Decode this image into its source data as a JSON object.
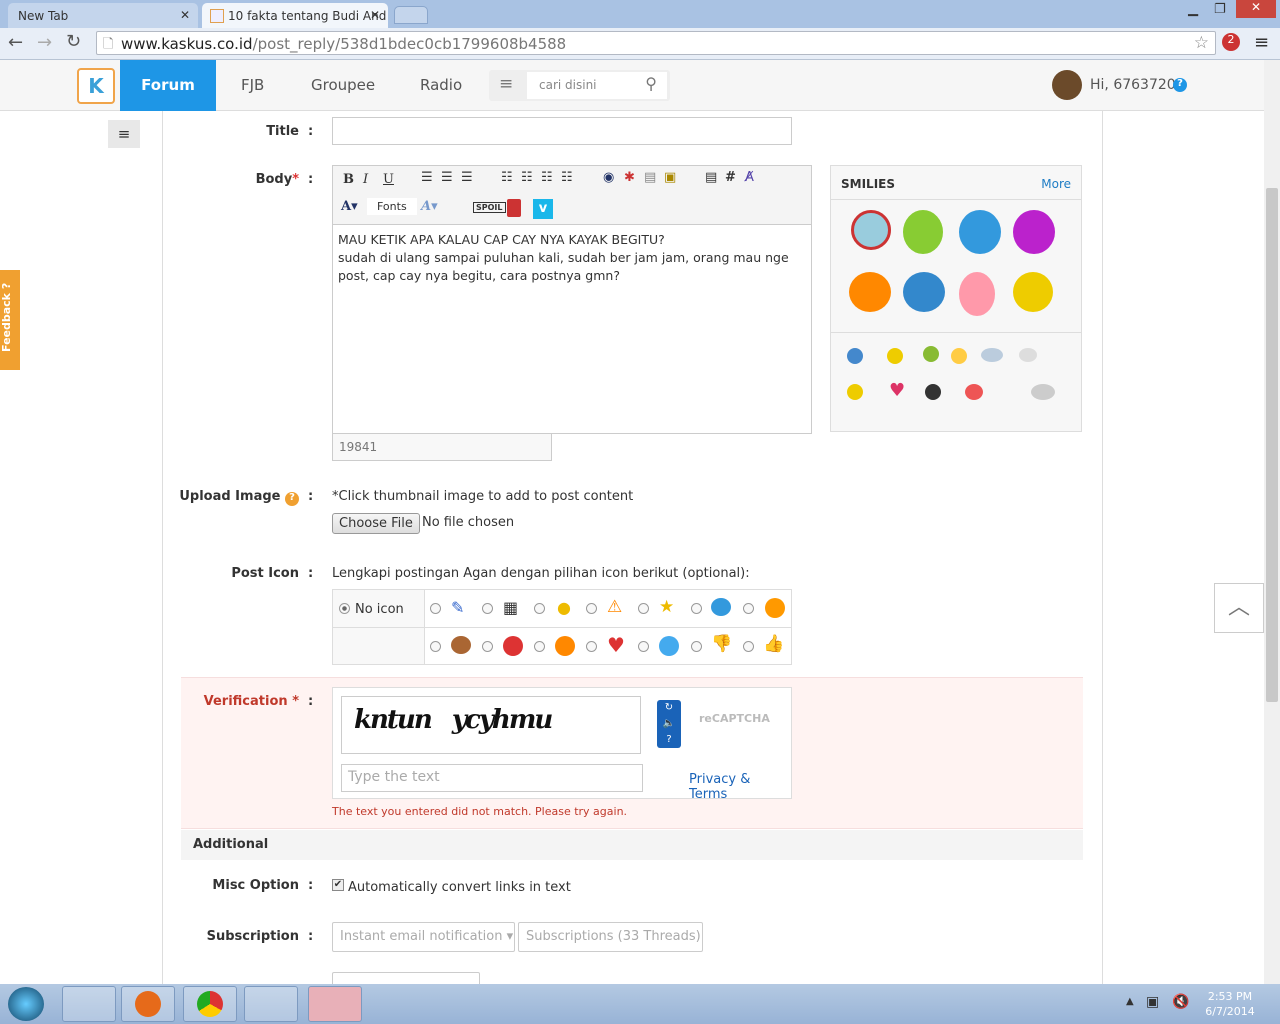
{
  "browser": {
    "tabs": [
      {
        "label": "New Tab"
      },
      {
        "label": "10 fakta tentang Budi And"
      }
    ],
    "url_host": "www.kaskus.co.id",
    "url_path": "/post_reply/538d1bdec0cb1799608b4588",
    "ext_badge": "2"
  },
  "nav": {
    "items": [
      "Forum",
      "FJB",
      "Groupee",
      "Radio"
    ],
    "search_placeholder": "cari disini",
    "greeting": "Hi, 6763720",
    "help": "?",
    "accent": "#1e96e6"
  },
  "feedback": "Feedback ?",
  "form": {
    "title_label": "Title",
    "colon": ":",
    "body_label": "Body",
    "required": "*",
    "toolbar": {
      "fonts": "Fonts",
      "spoil": "SPOIL"
    },
    "body_text": "MAU KETIK APA KALAU CAP CAY NYA KAYAK BEGITU?\nsudah di ulang sampai puluhan kali, sudah ber jam jam, orang mau nge post, cap cay nya begitu, cara postnya gmn?",
    "char_count": "19841",
    "smilies_title": "SMILIES",
    "smilies_more": "More",
    "upload_label": "Upload Image",
    "upload_hint": "*Click thumbnail image to add to post content",
    "choose_file": "Choose File",
    "no_file": "No file chosen",
    "post_icon_label": "Post Icon",
    "post_icon_hint": "Lengkapi postingan Agan dengan pilihan icon berikut (optional):",
    "no_icon": "No icon",
    "verification_label": "Verification",
    "captcha_placeholder": "Type the text",
    "privacy": "Privacy & Terms",
    "recaptcha": "reCAPTCHA",
    "captcha_error": "The text you entered did not match. Please try again.",
    "additional": "Additional",
    "misc_label": "Misc Option",
    "misc_text": "Automatically convert links in text",
    "misc_checked": true,
    "subscription_label": "Subscription",
    "sub_option1": "Instant email notification",
    "sub_option2": "Subscriptions (33 Threads)"
  },
  "taskbar": {
    "time": "2:53 PM",
    "date": "6/7/2014"
  }
}
